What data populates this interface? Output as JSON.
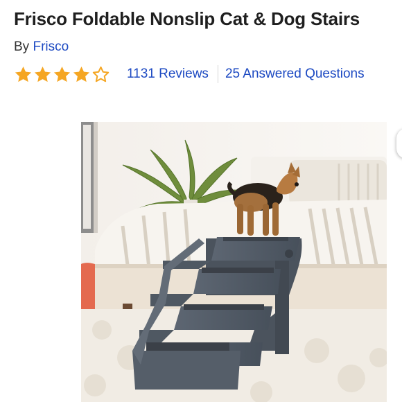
{
  "product": {
    "title": "Frisco Foldable Nonslip Cat & Dog Stairs",
    "by_label": "By",
    "brand": "Frisco"
  },
  "rating": {
    "stars": 4,
    "max_stars": 5,
    "star_color": "#f5a623",
    "reviews_label": "1131 Reviews",
    "questions_label": "25 Answered Questions"
  },
  "colors": {
    "title": "#1f1f1f",
    "link": "#1c49c2"
  },
  "image": {
    "icon": "product-photo"
  }
}
